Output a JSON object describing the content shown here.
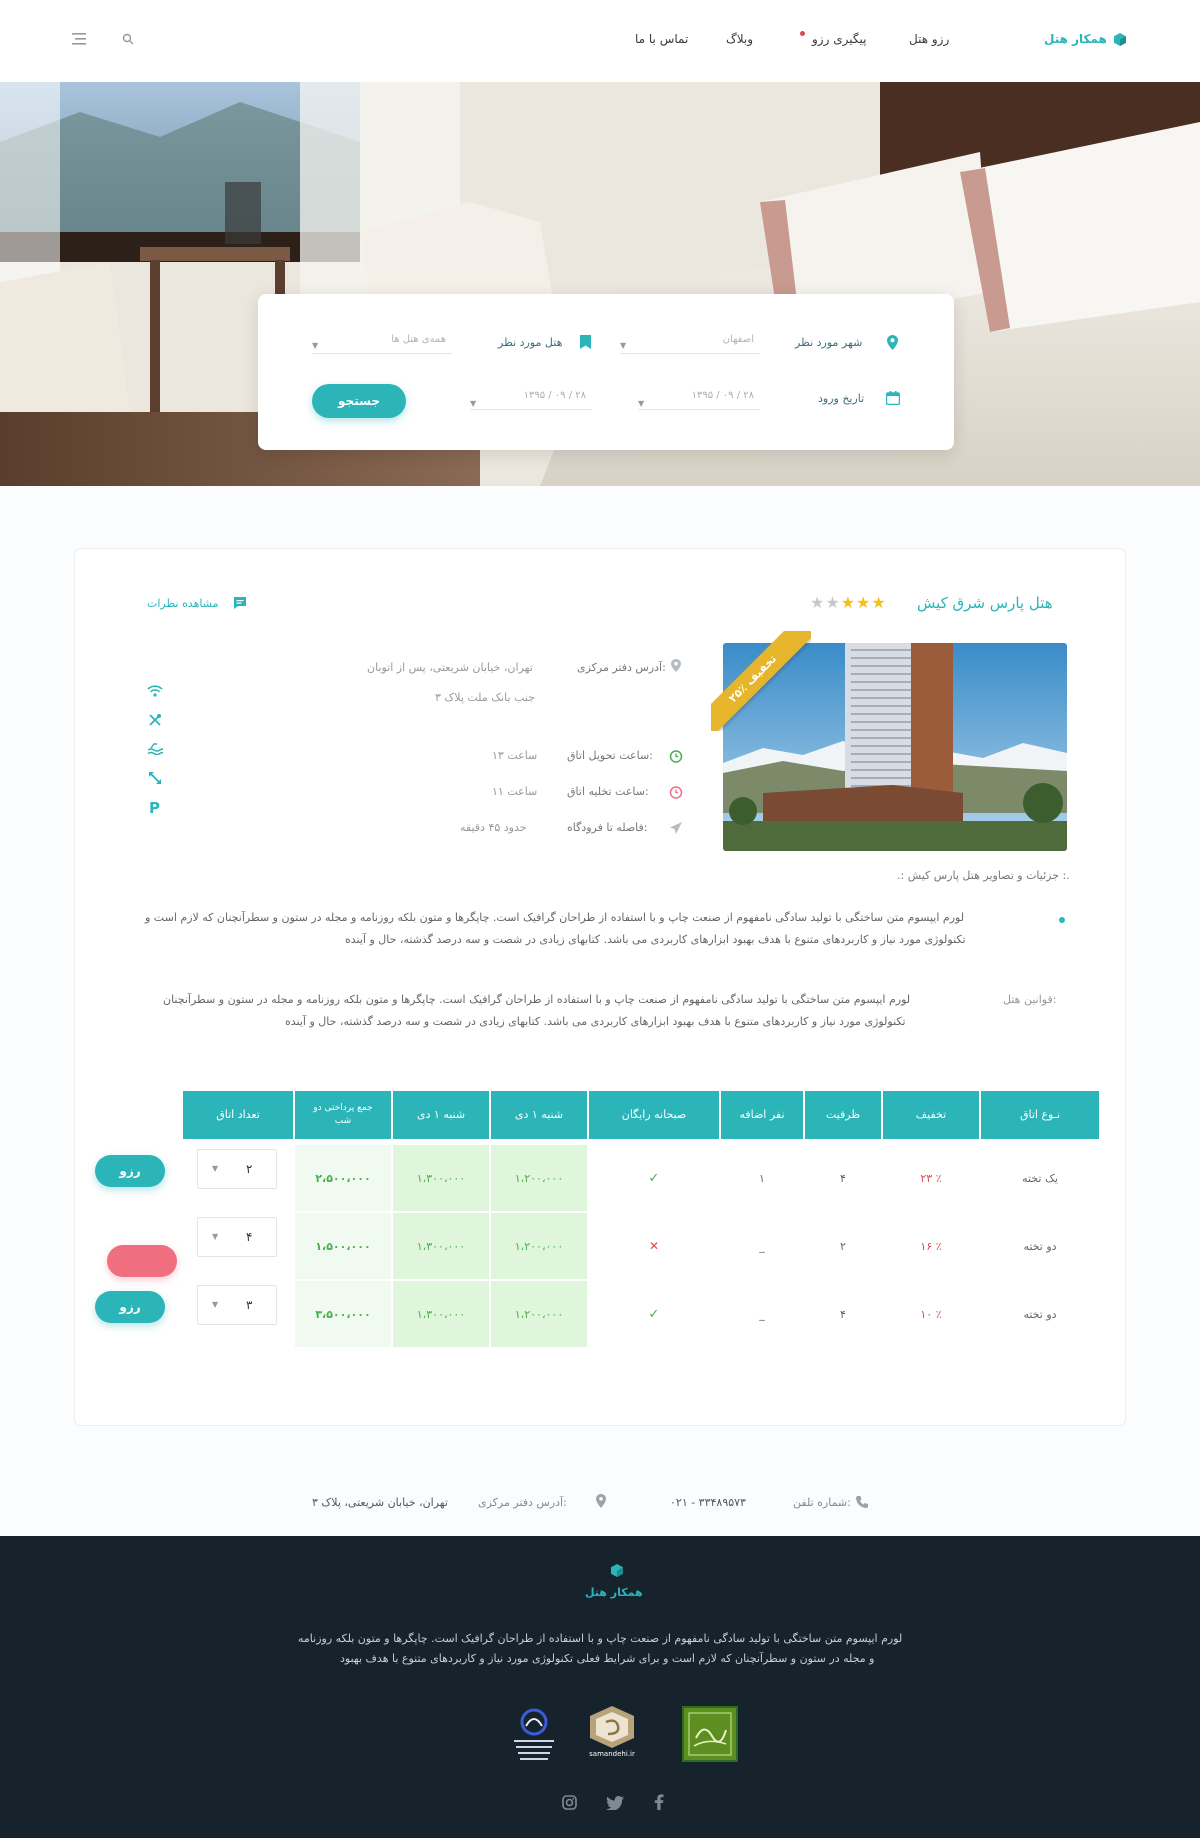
{
  "header": {
    "logo_text": "همکار هتل",
    "nav": [
      "رزو هتل",
      "پیگیری رزو",
      "وبلاگ",
      "تماس با ما"
    ]
  },
  "search": {
    "city_label": "شهر مورد نظر",
    "city_value": "اصفهان",
    "hotel_label": "هتل مورد نظر",
    "hotel_value": "همه‌ی هتل ها",
    "date_label": "تاریخ ورود",
    "date_in": "۱۳۹۵ / ۰۹ / ۲۸",
    "date_out": "۱۳۹۵ / ۰۹ / ۲۸",
    "search_button": "جستجو"
  },
  "hotel": {
    "name": "هتل پارس شرق کیش",
    "stars_filled": 3,
    "stars_total": 5,
    "reviews_link": "مشاهده نظرات",
    "discount_ribbon": "۲۵٪ تخفیف",
    "gallery_caption": ".: جزئیات و تصاویر هتل پارس کیش :.",
    "address_label": "آدرس دفتر مرکزی:",
    "address_line1": "تهران، خیابان شریعتی، پس از اتوبان",
    "address_line2": "جنب بانک ملت پلاک ۳",
    "checkin_label": "ساعت تحویل اتاق:",
    "checkin_value": "ساعت ۱۳",
    "checkout_label": "ساعت تخلیه اتاق:",
    "checkout_value": "ساعت ۱۱",
    "airport_label": "فاصله تا فرودگاه:",
    "airport_value": "حدود ۴۵ دقیقه",
    "description_line1": "لورم ایپسوم متن ساختگی با تولید سادگی نامفهوم از صنعت چاپ و با استفاده از طراحان گرافیک است. چاپگرها و متون بلکه روزنامه و مجله در ستون و سطرآنچنان که لازم است و",
    "description_line2": "تکنولوژی مورد نیاز و کاربردهای متنوع با هدف بهبود ابزارهای کاربردی می باشد. کتابهای زیادی در شصت و سه درصد گذشته، حال و آینده",
    "rules_label": "قوانین هتل:",
    "rules_line1": "لورم ایپسوم متن ساختگی با تولید سادگی نامفهوم از صنعت چاپ و با استفاده از طراحان گرافیک است. چاپگرها و متون بلکه روزنامه و مجله در ستون و سطرآنچنان",
    "rules_line2": "تکنولوژی مورد نیاز و کاربردهای متنوع با هدف بهبود ابزارهای کاربردی می باشد. کتابهای زیادی در شصت و سه درصد گذشته، حال و آینده"
  },
  "table": {
    "headers": [
      "نـوع اتاق",
      "تخفیف",
      "ظرفیت",
      "نفر اضافه",
      "صبحانه رایگان",
      "شنبه ۱ دی",
      "شنبه ۱ دی",
      "جمع پرداختی دو شب",
      "تعداد اتاق"
    ],
    "rows": [
      {
        "type": "یک تخته",
        "discount": "۲۳ ٪",
        "capacity": "۴",
        "extra": "۱",
        "breakfast": "yes",
        "night1": "۱،۲۰۰،۰۰۰",
        "night2": "۱،۳۰۰،۰۰۰",
        "total": "۲،۵۰۰،۰۰۰",
        "qty": "۲"
      },
      {
        "type": "دو تخته",
        "discount": "۱۶ ٪",
        "capacity": "۲",
        "extra": "_",
        "breakfast": "no",
        "night1": "۱،۲۰۰،۰۰۰",
        "night2": "۱،۳۰۰،۰۰۰",
        "total": "۱،۵۰۰،۰۰۰",
        "qty": "۴"
      },
      {
        "type": "دو تخته",
        "discount": "۱۰ ٪",
        "capacity": "۴",
        "extra": "_",
        "breakfast": "yes",
        "night1": "۱،۲۰۰،۰۰۰",
        "night2": "۱،۳۰۰،۰۰۰",
        "total": "۳،۵۰۰،۰۰۰",
        "qty": "۳"
      }
    ],
    "reserve_label": "رزو"
  },
  "contact": {
    "phone_label": "شماره تلفن:",
    "phone_value": "۰۲۱ - ۳۳۴۸۹۵۷۳",
    "address_label": "آدرس دفتر مرکزی:",
    "address_value": "تهران، خیابان شریعتی، پلاک ۳"
  },
  "footer": {
    "logo_text": "همکار هتل",
    "text_line1": "لورم ایپسوم متن ساختگی با تولید سادگی نامفهوم از صنعت چاپ و با استفاده از طراحان گرافیک است. چاپگرها و متون بلکه روزنامه",
    "text_line2": "و مجله در ستون و سطرآنچنان که لازم است و برای شرایط فعلی تکنولوژی مورد نیاز و کاربردهای متنوع با هدف بهبود",
    "badge_samandehi": "samandehi.ir"
  },
  "colors": {
    "accent": "#2bb5b8",
    "star": "#f3c01c",
    "footer_bg": "#16232d",
    "pink": "#ef6f80",
    "success": "#47b04b",
    "danger": "#e0474c"
  }
}
